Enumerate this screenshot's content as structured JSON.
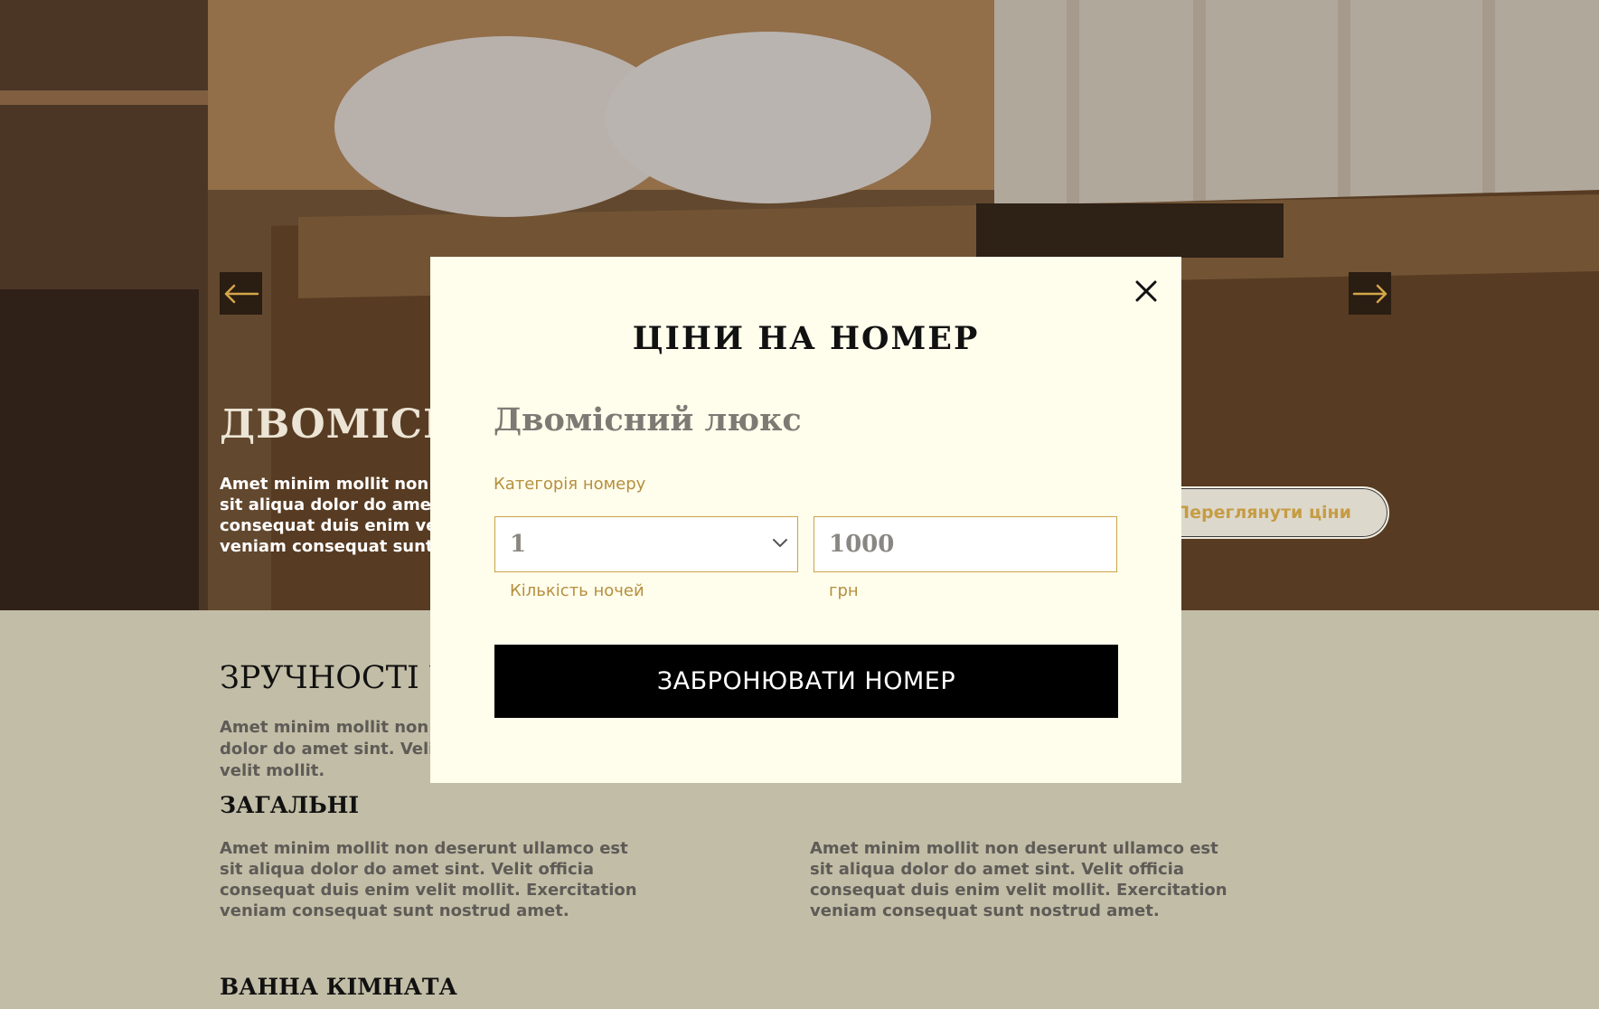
{
  "hero": {
    "title": "ДВОМІСНИЙ ЛЮКС",
    "description": "Amet minim mollit non deserunt ullamco est sit aliqua dolor do amet sint. Velit officia consequat duis enim velit mollit. Exercitation veniam consequat sunt nostrud amet.",
    "view_prices_label": "Переглянути ціни",
    "prev_icon": "arrow-left-icon",
    "next_icon": "arrow-right-icon"
  },
  "amenities": {
    "title": "ЗРУЧНОСТІ У НОМЕРІ",
    "lead": "Amet minim mollit non deserunt ullamco est sit aliqua dolor do amet sint. Velit officia consequat duis enim velit mollit.",
    "general": {
      "heading": "ЗАГАЛЬНІ",
      "left_text": "Amet minim mollit non deserunt ullamco est sit aliqua dolor do amet sint. Velit officia consequat duis enim velit mollit. Exercitation veniam consequat sunt nostrud amet.",
      "right_text": "Amet minim mollit non deserunt ullamco est sit aliqua dolor do amet sint. Velit officia consequat duis enim velit mollit. Exercitation veniam consequat sunt nostrud amet."
    },
    "bathroom": {
      "heading": "ВАННА КІМНАТА"
    }
  },
  "modal": {
    "title": "ЦІНИ НА НОМЕР",
    "room_name": "Двомісний люкс",
    "category_label": "Категорія номеру",
    "nights_value": "1",
    "nights_hint": "Кількість ночей",
    "price_value": "1000",
    "price_hint": "грн",
    "book_label": "ЗАБРОНЮВАТИ НОМЕР",
    "close_icon": "close-icon"
  },
  "colors": {
    "modal_bg": "#fffdec",
    "accent_gold": "#c69c43",
    "page_bg": "#c2bda6",
    "button_bg": "#000000"
  }
}
